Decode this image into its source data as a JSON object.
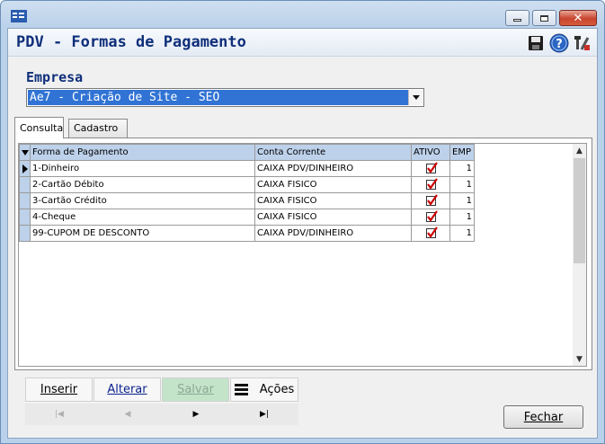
{
  "window": {
    "title": "PDV - Formas de Pagamento",
    "controls": [
      "minimize",
      "maximize",
      "close"
    ]
  },
  "header_icons": [
    "save-icon",
    "help-icon",
    "tools-icon"
  ],
  "empresa": {
    "label": "Empresa",
    "selected": "Ae7 - Criação de Site - SEO"
  },
  "tabs": [
    {
      "label": "Consulta",
      "active": true
    },
    {
      "label": "Cadastro",
      "active": false
    }
  ],
  "grid": {
    "columns": [
      "Forma de Pagamento",
      "Conta Corrente",
      "ATIVO",
      "EMP"
    ],
    "rows": [
      {
        "forma": "1-Dinheiro",
        "conta": "CAIXA PDV/DINHEIRO",
        "ativo": true,
        "emp": "1",
        "current": true
      },
      {
        "forma": "2-Cartão Débito",
        "conta": "CAIXA FISICO",
        "ativo": true,
        "emp": "1",
        "current": false
      },
      {
        "forma": "3-Cartão Crédito",
        "conta": "CAIXA FISICO",
        "ativo": true,
        "emp": "1",
        "current": false
      },
      {
        "forma": "4-Cheque",
        "conta": "CAIXA FISICO",
        "ativo": true,
        "emp": "1",
        "current": false
      },
      {
        "forma": "99-CUPOM DE DESCONTO",
        "conta": "CAIXA PDV/DINHEIRO",
        "ativo": true,
        "emp": "1",
        "current": false
      }
    ]
  },
  "toolbar": {
    "inserir": "Inserir",
    "alterar": "Alterar",
    "salvar": "Salvar",
    "acoes": "Ações"
  },
  "navigator": {
    "first": "|◀",
    "prior": "◀",
    "next": "▶",
    "last": "▶|"
  },
  "fechar": "Fechar",
  "colors": {
    "title_text": "#0f2f7a",
    "selection": "#3073d4",
    "grid_header": "#bdd1ea",
    "check_red": "#cc0000"
  }
}
